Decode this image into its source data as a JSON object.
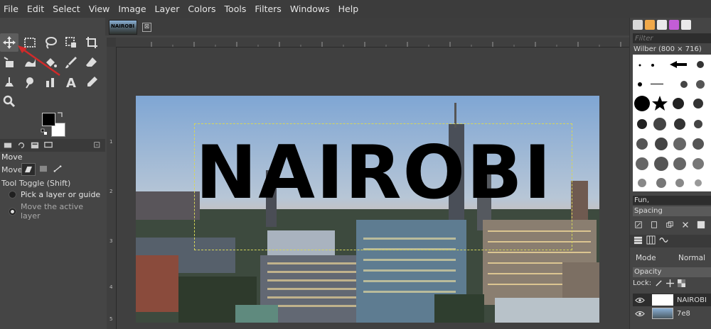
{
  "menubar": {
    "items": [
      "File",
      "Edit",
      "Select",
      "View",
      "Image",
      "Layer",
      "Colors",
      "Tools",
      "Filters",
      "Windows",
      "Help"
    ]
  },
  "image_tab": {
    "thumb_text": "NAIROBI",
    "close_glyph": "⊠"
  },
  "rulers": {
    "vertical_labels": [
      "1",
      "2",
      "3",
      "4",
      "5"
    ]
  },
  "canvas": {
    "overlay_text": "NAIROBI"
  },
  "tool_options": {
    "title": "Move",
    "move_label": "Move:",
    "toggle_label": "Tool Toggle  (Shift)",
    "option_pick": "Pick a layer or guide",
    "option_move": "Move the active layer",
    "selected": "Move the active layer"
  },
  "brushes": {
    "filter_placeholder": "Filter",
    "brush_name": "Wilber (800 × 716)",
    "current_brush": "Fun,",
    "spacing_label": "Spacing"
  },
  "layers": {
    "mode_label": "Mode",
    "mode_value": "Normal",
    "opacity_label": "Opacity",
    "lock_label": "Lock:",
    "items": [
      {
        "name": "NAIROBI",
        "selected": true
      },
      {
        "name": "7e8",
        "selected": false
      }
    ]
  },
  "colors": {
    "foreground": "#000000",
    "background": "#ffffff",
    "boundary": "#d6d65a",
    "annotation_arrow": "#d12a2a"
  }
}
